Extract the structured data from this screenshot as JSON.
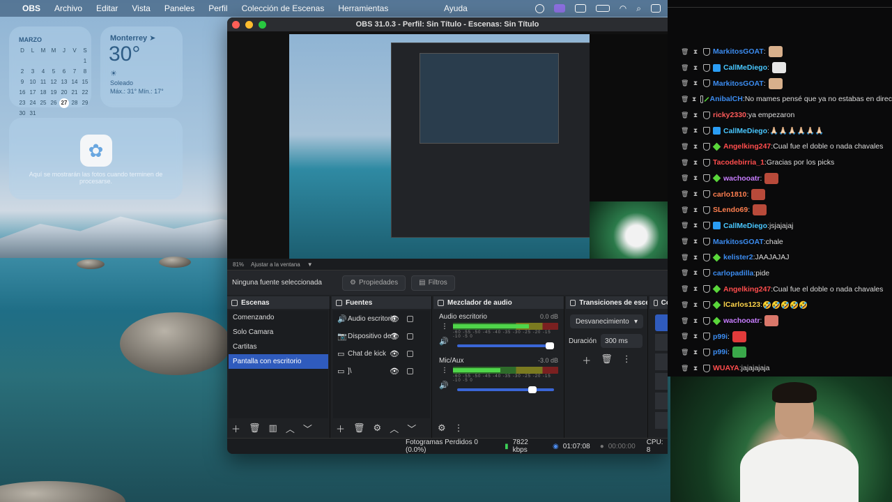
{
  "menubar": {
    "app": "OBS",
    "menus": [
      "Archivo",
      "Editar",
      "Vista",
      "Paneles",
      "Perfil",
      "Colección de Escenas",
      "Herramientas"
    ],
    "help": "Ayuda"
  },
  "calendar": {
    "month": "MARZO",
    "weekdays": [
      "D",
      "L",
      "M",
      "M",
      "J",
      "V",
      "S"
    ],
    "days": [
      "",
      "",
      "",
      "",
      "",
      "",
      "1",
      "2",
      "3",
      "4",
      "5",
      "6",
      "7",
      "8",
      "9",
      "10",
      "11",
      "12",
      "13",
      "14",
      "15",
      "16",
      "17",
      "18",
      "19",
      "20",
      "21",
      "22",
      "23",
      "24",
      "25",
      "26",
      "27",
      "28",
      "29",
      "30",
      "31"
    ],
    "today": "27"
  },
  "weather": {
    "city": "Monterrey",
    "temp": "30°",
    "condition": "Soleado",
    "hilo": "Máx.: 31° Mín.: 17°"
  },
  "photos_widget": {
    "message": "Aquí se mostrarán las fotos cuando terminen de procesarse."
  },
  "obs": {
    "title": "OBS 31.0.3 - Perfil: Sin Título - Escenas: Sin Título",
    "zoom": "81%",
    "fit": "Ajustar a la ventana",
    "no_source": "Ninguna fuente seleccionada",
    "properties_btn": "Propiedades",
    "filters_btn": "Filtros",
    "scenes": {
      "title": "Escenas",
      "items": [
        "Comenzando",
        "Solo Camara",
        "Cartitas",
        "Pantalla con escritorio"
      ]
    },
    "sources": {
      "title": "Fuentes",
      "items": [
        "Audio escritorio",
        "Dispositivo de c",
        "Chat de kick",
        "]\\"
      ]
    },
    "mixer": {
      "title": "Mezclador de audio",
      "channels": [
        {
          "name": "Audio escritorio",
          "db": "0.0 dB",
          "level": 0.72,
          "volume": 1.0
        },
        {
          "name": "Mic/Aux",
          "db": "-3.0 dB",
          "level": 0.45,
          "volume": 0.82
        }
      ],
      "scale": "-60 -55 -50 -45 -40 -35 -30 -25 -20 -15 -10 -5 0"
    },
    "transitions": {
      "title": "Transiciones de esce...",
      "type": "Desvanecimiento",
      "duration_label": "Duración",
      "duration": "300 ms"
    },
    "controls_head": "Co",
    "status": {
      "dropped": "Fotogramas Perdidos 0 (0.0%)",
      "bitrate": "7822 kbps",
      "live_time": "01:07:08",
      "rec_time": "00:00:00",
      "cpu": "CPU: 8"
    }
  },
  "chat": {
    "messages": [
      {
        "user": "MarkitosGOAT",
        "color": "#3c8cf0",
        "badge": "shield",
        "text": "",
        "emote": "#d8b08c"
      },
      {
        "user": "CallMeDiego",
        "color": "#49c7ff",
        "badge": "blue",
        "text": "",
        "emote": "#e6e6e6"
      },
      {
        "user": "MarkitosGOAT",
        "color": "#3c8cf0",
        "badge": "shield",
        "text": "",
        "emote": "#d8b08c"
      },
      {
        "user": "AnibalCH",
        "color": "#3c8cf0",
        "badge": "green",
        "text": "No mames pensé que ya no estabas en direc",
        "emote": ""
      },
      {
        "user": "ricky2330",
        "color": "#ff5a5a",
        "badge": "shield",
        "text": "ya empezaron",
        "emote": ""
      },
      {
        "user": "CallMeDiego",
        "color": "#49c7ff",
        "badge": "blue",
        "text": "🙏🏻🙏🏻🙏🏻🙏🏻🙏🏻🙏🏻",
        "emote": ""
      },
      {
        "user": "Angelking247",
        "color": "#ff4d4d",
        "badge": "green",
        "text": "Cual fue el doble o nada chavales",
        "emote": ""
      },
      {
        "user": "Tacodebirria_1",
        "color": "#ff4d4d",
        "badge": "shield",
        "text": "Gracias por los picks",
        "emote": ""
      },
      {
        "user": "wachooatr",
        "color": "#c77dff",
        "badge": "green",
        "text": "",
        "emote": "#b84a3a"
      },
      {
        "user": "carlo1810",
        "color": "#ff7f50",
        "badge": "shield",
        "text": "",
        "emote": "#b84a3a"
      },
      {
        "user": "SLendo69",
        "color": "#ff7f50",
        "badge": "shield",
        "text": "",
        "emote": "#b84a3a"
      },
      {
        "user": "CallMeDiego",
        "color": "#49c7ff",
        "badge": "blue",
        "text": "jsjajajaj",
        "emote": ""
      },
      {
        "user": "MarkitosGOAT",
        "color": "#3c8cf0",
        "badge": "shield",
        "text": "chale",
        "emote": ""
      },
      {
        "user": "kelister2",
        "color": "#3c8cf0",
        "badge": "green",
        "text": "JAAJAJAJ",
        "emote": ""
      },
      {
        "user": "carlopadilla",
        "color": "#3c8cf0",
        "badge": "shield",
        "text": "pide",
        "emote": ""
      },
      {
        "user": "Angelking247",
        "color": "#ff4d4d",
        "badge": "green",
        "text": "Cual fue el doble o nada chavales",
        "emote": ""
      },
      {
        "user": "lCarlos123",
        "color": "#ffd54a",
        "badge": "green",
        "text": "🤣🤣🤣🤣🤣",
        "emote": ""
      },
      {
        "user": "wachooatr",
        "color": "#c77dff",
        "badge": "green",
        "text": "",
        "emote": "#d9776a"
      },
      {
        "user": "p99i",
        "color": "#3c8cf0",
        "badge": "shield",
        "text": "",
        "emote": "#e23b3b"
      },
      {
        "user": "p99i",
        "color": "#3c8cf0",
        "badge": "shield",
        "text": "",
        "emote": "#3aa84a"
      },
      {
        "user": "WUAYA",
        "color": "#ff4d4d",
        "badge": "shield",
        "text": "jajajajaja",
        "emote": ""
      }
    ]
  }
}
